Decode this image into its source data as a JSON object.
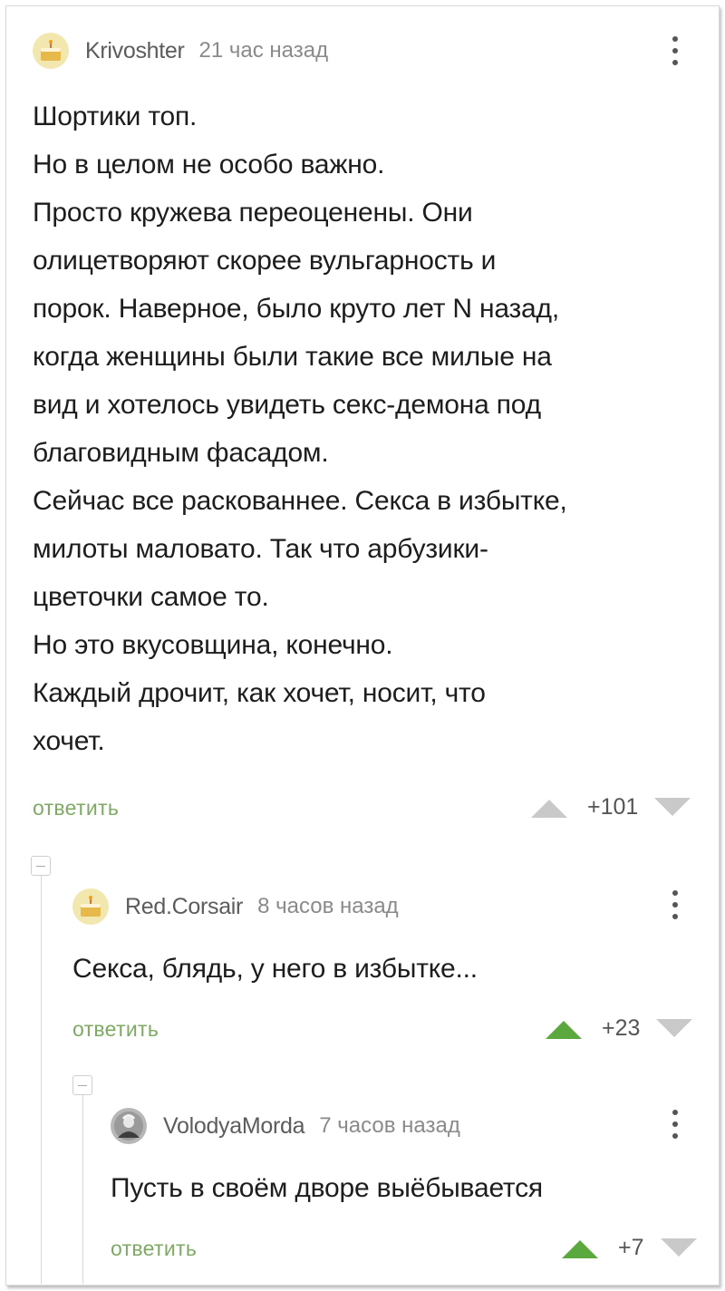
{
  "comments": [
    {
      "author": "Krivoshter",
      "time": "21 час назад",
      "lines": [
        "Шортики топ.",
        "Но в целом не особо важно.",
        "Просто кружева переоценены. Они",
        "олицетворяют скорее вульгарность и",
        "порок. Наверное, было круто лет N назад,",
        "когда женщины были такие все милые на",
        "вид и хотелось увидеть секс-демона под",
        "благовидным фасадом.",
        "Сейчас все раскованнее. Секса в избытке,",
        "милоты маловато. Так что арбузики-",
        "цветочки самое то.",
        "Но это вкусовщина, конечно.",
        "Каждый дрочит, как хочет, носит, что",
        "хочет."
      ],
      "reply_label": "ответить",
      "score": "+101",
      "upvoted": false
    },
    {
      "author": "Red.Corsair",
      "time": "8 часов назад",
      "lines": [
        "Секса, блядь, у него в избытке..."
      ],
      "reply_label": "ответить",
      "score": "+23",
      "upvoted": true
    },
    {
      "author": "VolodyaMorda",
      "time": "7 часов назад",
      "lines": [
        "Пусть в своём дворе выёбывается"
      ],
      "reply_label": "ответить",
      "score": "+7",
      "upvoted": true
    }
  ],
  "colors": {
    "upvote_active": "#5aa83e",
    "vote_inactive": "#c9c9c9",
    "reply_link": "#7eaa63"
  },
  "icons": {
    "avatar_1": "avatar-cake-icon",
    "avatar_2": "avatar-cake-icon",
    "avatar_3": "avatar-witcher-icon",
    "menu": "more-vertical-icon",
    "upvote": "arrow-up-icon",
    "downvote": "arrow-down-icon",
    "collapse": "minus-square-icon"
  }
}
